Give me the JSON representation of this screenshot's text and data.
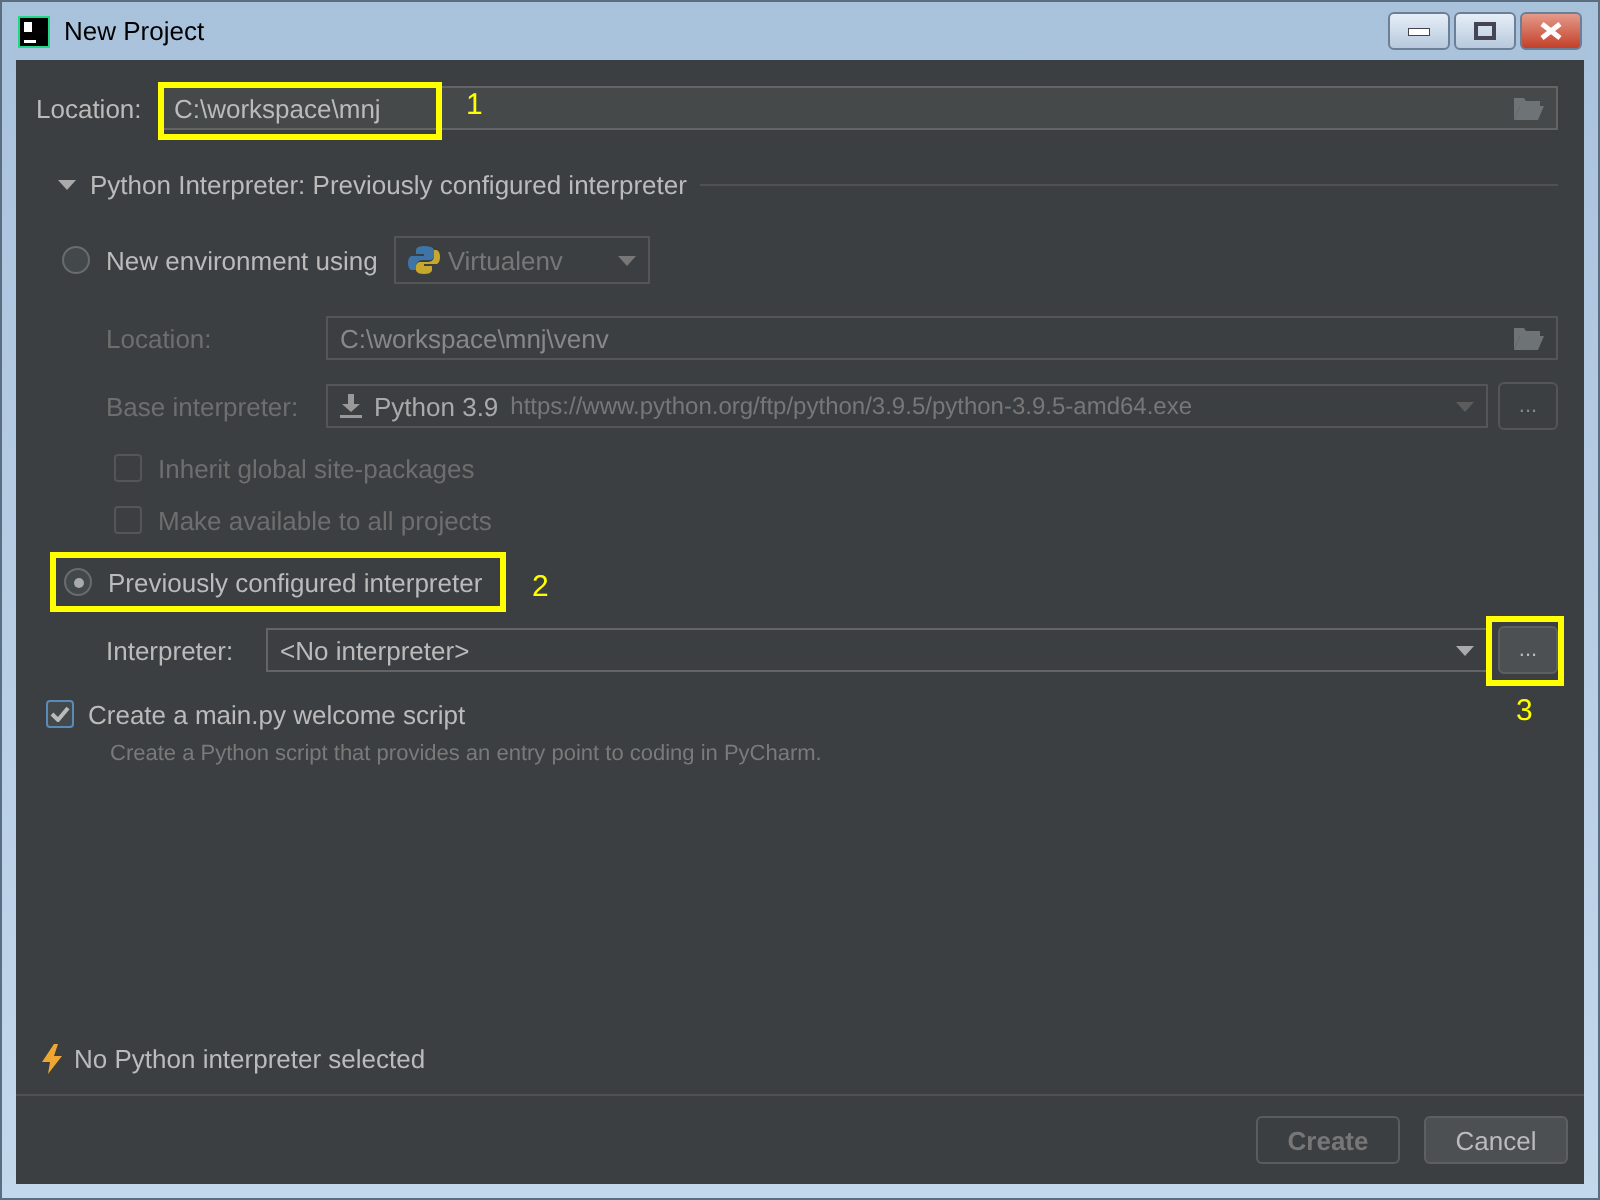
{
  "window": {
    "title": "New Project"
  },
  "location": {
    "label": "Location:",
    "value": "C:\\workspace\\mnj"
  },
  "interpreter_section": {
    "title": "Python Interpreter: Previously configured interpreter",
    "expanded": true
  },
  "new_environment": {
    "label": "New environment using",
    "selected": false,
    "tool": "Virtualenv",
    "location_label": "Location:",
    "location_value": "C:\\workspace\\mnj\\venv",
    "base_label": "Base interpreter:",
    "base_name": "Python 3.9",
    "base_url": "https://www.python.org/ftp/python/3.9.5/python-3.9.5-amd64.exe",
    "browse_button": "...",
    "checkboxes": [
      {
        "label": "Inherit global site-packages",
        "checked": false
      },
      {
        "label": "Make available to all projects",
        "checked": false
      }
    ]
  },
  "previous_interpreter": {
    "label": "Previously configured interpreter",
    "selected": true,
    "interpreter_label": "Interpreter:",
    "interpreter_value": "<No interpreter>",
    "browse_button": "..."
  },
  "welcome_script": {
    "label": "Create a main.py welcome script",
    "checked": true,
    "hint": "Create a Python script that provides an entry point to coding in PyCharm."
  },
  "warning": "No Python interpreter selected",
  "buttons": [
    {
      "label": "Create",
      "disabled": true
    },
    {
      "label": "Cancel",
      "disabled": false
    }
  ],
  "annotations": [
    {
      "label": "1"
    },
    {
      "label": "2"
    },
    {
      "label": "3"
    }
  ]
}
